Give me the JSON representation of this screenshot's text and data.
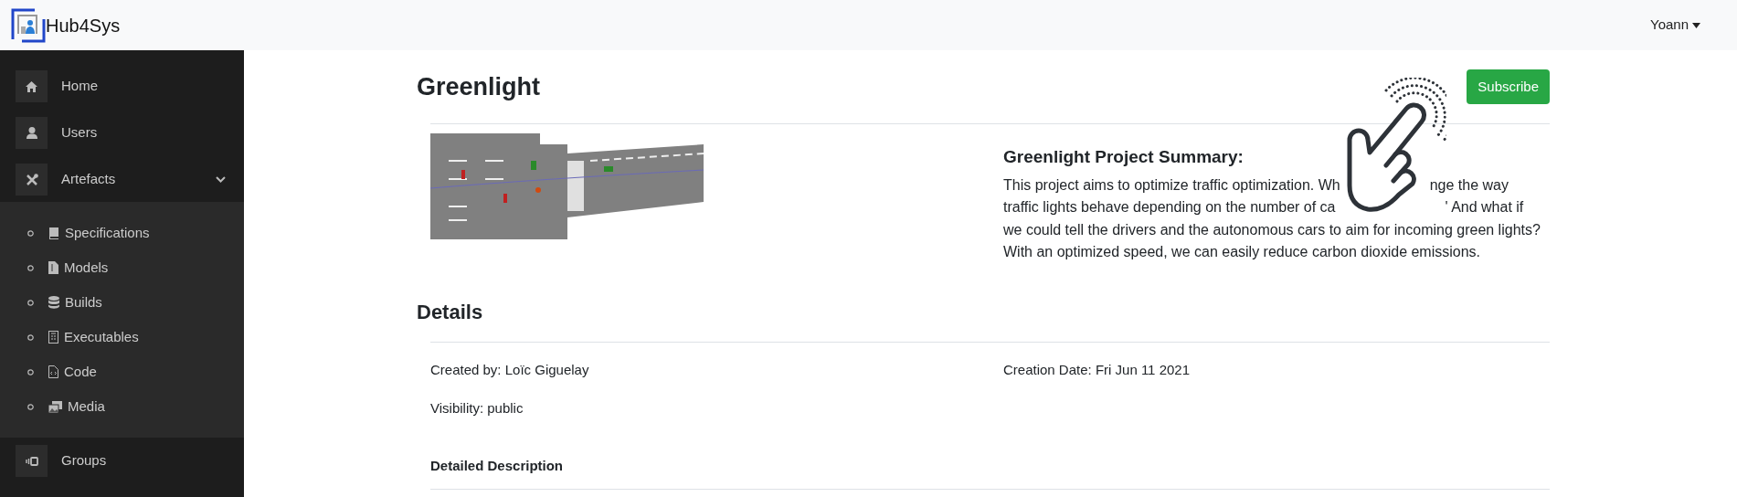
{
  "header": {
    "brand": "Hub4Sys",
    "user": "Yoann"
  },
  "sidebar": {
    "items": [
      {
        "label": "Home"
      },
      {
        "label": "Users"
      },
      {
        "label": "Artefacts",
        "expanded": true,
        "children": [
          {
            "label": "Specifications"
          },
          {
            "label": "Models"
          },
          {
            "label": "Builds"
          },
          {
            "label": "Executables"
          },
          {
            "label": "Code"
          },
          {
            "label": "Media"
          }
        ]
      },
      {
        "label": "Groups"
      }
    ]
  },
  "project": {
    "title": "Greenlight",
    "subscribe": "Subscribe",
    "summary": {
      "heading": "Greenlight Project Summary:",
      "lines": [
        {
          "left": "This project aims to optimize traffic optimization. Wh",
          "right": "nge the way"
        },
        {
          "left": "traffic lights behave depending on the number of ca",
          "right": "' And what if"
        },
        {
          "left": "we could tell the drivers and the autonomous cars to aim for incoming green lights?"
        },
        {
          "left": "With an optimized speed, we can easily reduce carbon dioxide emissions."
        }
      ]
    }
  },
  "details": {
    "heading": "Details",
    "created_by": "Created by: Loïc Giguelay",
    "creation_date": "Creation Date: Fri Jun 11 2021",
    "visibility": "Visibility: public",
    "description_heading": "Detailed Description"
  }
}
